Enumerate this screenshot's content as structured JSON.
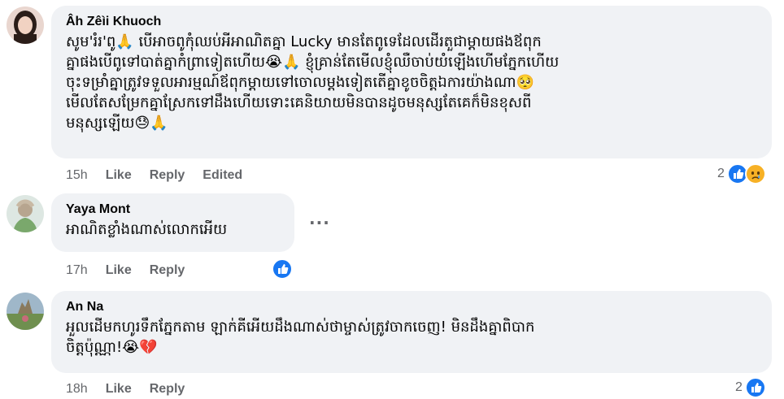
{
  "comments": [
    {
      "author": "Âh Zêìi Khuoch",
      "lines": [
        "សូម'រំរ'ពូ🙏 បើអាចពូកុំឈប់អីអាណិតគ្នា Lucky មានតែពូទេដែលដើរតួជាម្ដាយផងឪពុក",
        "គ្នាផងបើពូទៅបាត់គ្នាកំព្រាទៀតហើយ😭🙏 ខ្ញុំគ្រាន់តែមើលខ្ញុំឈឺចាប់យំឡើងហើមភ្នែកហើយ",
        "ចុះទម្រាំគ្នាត្រូវទទួលអារម្មណ៍ឪពុកម្ដាយទៅចោលម្ដងទៀតតើគ្នាខូចចិត្តឯការយ៉ាងណា🥺",
        "មើលតែសម្រែកគ្នាស្រែកទៅដឹងហើយទោះគេនិយាយមិនបានដូចមនុស្សតែគេក៏មិនខុសពី",
        "មនុស្សឡើយ😓🙏"
      ],
      "time": "15h",
      "like": "Like",
      "reply": "Reply",
      "edited": "Edited",
      "reaction_count": "2",
      "reactions": [
        "like-icon",
        "sad-icon"
      ]
    },
    {
      "author": "Yaya Mont",
      "lines": [
        "អាណិតខ្លាំងណាស់លោកអើយ"
      ],
      "time": "17h",
      "like": "Like",
      "reply": "Reply",
      "reaction_count": "",
      "reactions": [
        "like-icon"
      ],
      "more": "···"
    },
    {
      "author": "An Na",
      "lines": [
        "អួលដើមកហូរទឹកភ្នែកតាម ឡាក់គីអើយដឹងណាស់ថាម្ចាស់ត្រូវចាកចេញ! មិនដឹងគ្នាពិបាក",
        "ចិត្តប៉ុណ្ណា!😭💔"
      ],
      "time": "18h",
      "like": "Like",
      "reply": "Reply",
      "reaction_count": "2",
      "reactions": [
        "like-icon"
      ]
    }
  ],
  "colors": {
    "bubble": "#f0f2f5",
    "meta_text": "#65676b",
    "like_blue": "#1877f2",
    "sad_yellow": "#f7b125"
  }
}
